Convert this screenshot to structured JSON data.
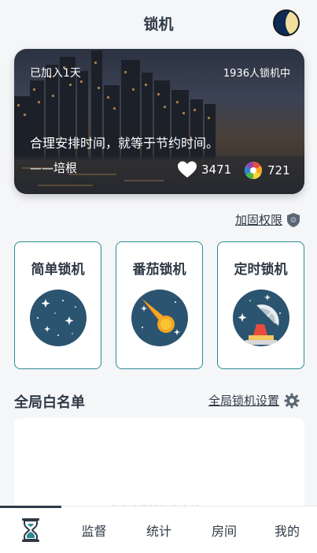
{
  "header": {
    "title": "锁机"
  },
  "hero": {
    "joined": "已加入1天",
    "online_count": "1936人锁机中",
    "quote": "合理安排时间，就等于节约时间。",
    "author": "——培根",
    "likes": "3471",
    "views": "721"
  },
  "permission": {
    "label": "加固权限"
  },
  "modes": [
    {
      "label": "简单锁机",
      "icon": "starry-sky-icon"
    },
    {
      "label": "番茄锁机",
      "icon": "comet-icon"
    },
    {
      "label": "定时锁机",
      "icon": "satellite-dish-icon"
    }
  ],
  "whitelist": {
    "title": "全局白名单",
    "settings_label": "全局锁机设置",
    "hint": "点击这里添加白名单..."
  },
  "tabbar": {
    "items": [
      {
        "label": "",
        "icon": "hourglass-icon",
        "active": true
      },
      {
        "label": "监督"
      },
      {
        "label": "统计"
      },
      {
        "label": "房间"
      },
      {
        "label": "我的"
      }
    ]
  },
  "colors": {
    "accent": "#2a8a96",
    "text": "#2e3a46",
    "icon_bg": "#2b5470"
  }
}
